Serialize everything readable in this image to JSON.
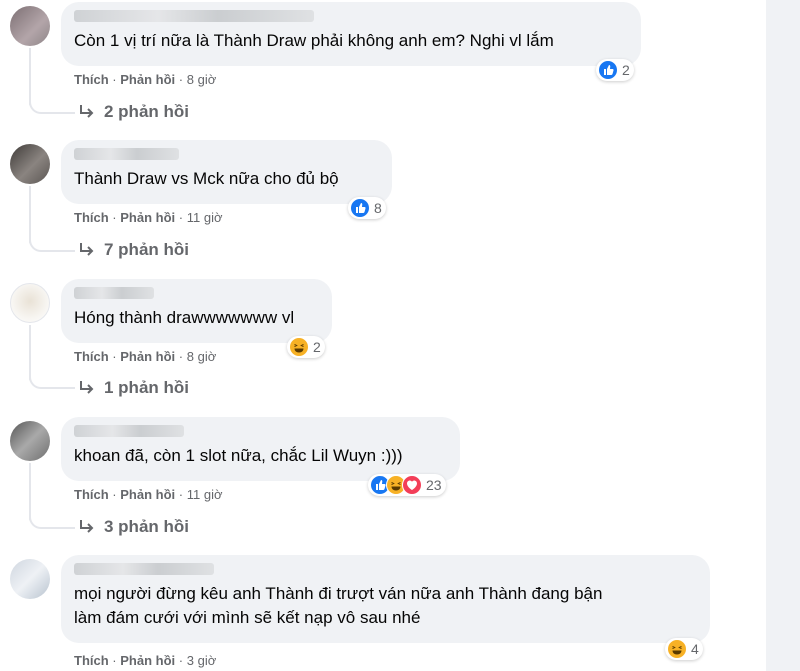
{
  "comments": [
    {
      "text": "Còn 1 vị trí nữa là Thành Draw phải không anh em? Nghi vl lắm",
      "actions": {
        "like": "Thích",
        "reply": "Phản hồi",
        "sep": "·",
        "time": "8 giờ"
      },
      "reactions": {
        "icons": [
          "like-icon"
        ],
        "count": "2"
      },
      "replies_label": "2 phản hồi"
    },
    {
      "text": "Thành Draw vs Mck nữa cho đủ bộ",
      "actions": {
        "like": "Thích",
        "reply": "Phản hồi",
        "sep": "·",
        "time": "11 giờ"
      },
      "reactions": {
        "icons": [
          "like-icon"
        ],
        "count": "8"
      },
      "replies_label": "7 phản hồi"
    },
    {
      "text": "Hóng thành drawwwwwww vl",
      "actions": {
        "like": "Thích",
        "reply": "Phản hồi",
        "sep": "·",
        "time": "8 giờ"
      },
      "reactions": {
        "icons": [
          "haha-icon"
        ],
        "count": "2"
      },
      "replies_label": "1 phản hồi"
    },
    {
      "text": "khoan đã, còn 1 slot nữa, chắc Lil Wuyn :)))",
      "actions": {
        "like": "Thích",
        "reply": "Phản hồi",
        "sep": "·",
        "time": "11 giờ"
      },
      "reactions": {
        "icons": [
          "like-icon",
          "haha-icon",
          "love-icon"
        ],
        "count": "23"
      },
      "replies_label": "3 phản hồi"
    },
    {
      "text": "mọi người đừng kêu anh Thành đi trượt ván nữa anh Thành đang bận\nlàm đám cưới với mình sẽ kết nạp vô sau nhé",
      "actions": {
        "like": "Thích",
        "reply": "Phản hồi",
        "sep": "·",
        "time": "3 giờ"
      },
      "reactions": {
        "icons": [
          "haha-icon"
        ],
        "count": "4"
      },
      "replies_label": ""
    }
  ],
  "colors": {
    "bubble": "#f0f2f5",
    "muted_text": "#65676b",
    "like_blue": "#1877f2",
    "haha_yellow": "#f7b125",
    "love_red": "#f33e58"
  }
}
